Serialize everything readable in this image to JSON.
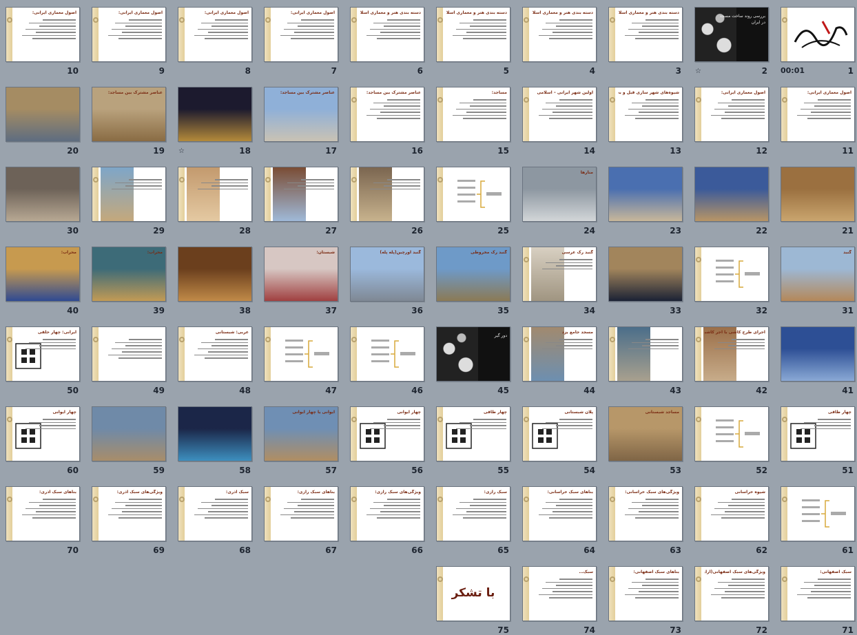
{
  "slides": [
    {
      "n": "1",
      "title": "",
      "kind": "calligraphy",
      "time": "00:01"
    },
    {
      "n": "2",
      "title": "بررسی روند ساخت مسجد در ایران",
      "kind": "dark",
      "star": "☆"
    },
    {
      "n": "3",
      "title": "دسته بندی هنر و معماری اسلامی",
      "kind": "text"
    },
    {
      "n": "4",
      "title": "دسته بندی هنر و معماری اسلامی",
      "kind": "text"
    },
    {
      "n": "5",
      "title": "دسته بندی هنر و معماری اسلامی",
      "kind": "text"
    },
    {
      "n": "6",
      "title": "دسته بندی هنر و معماری اسلامی",
      "kind": "text"
    },
    {
      "n": "7",
      "title": "اصول معماری ایرانی:",
      "kind": "text"
    },
    {
      "n": "8",
      "title": "اصول معماری ایرانی:",
      "kind": "text"
    },
    {
      "n": "9",
      "title": "اصول معماری ایرانی:",
      "kind": "text"
    },
    {
      "n": "10",
      "title": "اصول معماری ایرانی:",
      "kind": "text"
    },
    {
      "n": "11",
      "title": "اصول معماری ایرانی:",
      "kind": "text"
    },
    {
      "n": "12",
      "title": "اصول معماری ایرانی:",
      "kind": "text"
    },
    {
      "n": "13",
      "title": "شیوه‌های شهر سازی قبل و بعد اسلام:",
      "kind": "text"
    },
    {
      "n": "14",
      "title": "اولین شهر ایرانی – اسلامی",
      "kind": "text"
    },
    {
      "n": "15",
      "title": "مساجد:",
      "kind": "text"
    },
    {
      "n": "16",
      "title": "عناصر مشترک بین مساجد:",
      "kind": "text"
    },
    {
      "n": "17",
      "title": "عناصر مشترک بین مساجد:",
      "kind": "photo",
      "c1": "#8fb0d8",
      "c2": "#c9c2b4"
    },
    {
      "n": "18",
      "title": "",
      "kind": "photo",
      "c1": "#1c1a2e",
      "c2": "#b48a3a",
      "star": "☆"
    },
    {
      "n": "19",
      "title": "عناصر مشترک بین مساجد:",
      "kind": "photo",
      "c1": "#b9a27d",
      "c2": "#8a6c44"
    },
    {
      "n": "20",
      "title": "",
      "kind": "photo",
      "c1": "#a58c63",
      "c2": "#5e6d80"
    },
    {
      "n": "21",
      "title": "",
      "kind": "photo",
      "c1": "#9b7040",
      "c2": "#c9a56e"
    },
    {
      "n": "22",
      "title": "",
      "kind": "photo",
      "c1": "#3b5a9a",
      "c2": "#b89566"
    },
    {
      "n": "23",
      "title": "",
      "kind": "photo",
      "c1": "#4a6fb0",
      "c2": "#c8b79a"
    },
    {
      "n": "24",
      "title": "منارها",
      "kind": "photo",
      "c1": "#8d97a1",
      "c2": "#d2d6d8"
    },
    {
      "n": "25",
      "title": "",
      "kind": "diagram"
    },
    {
      "n": "26",
      "title": "",
      "kind": "halfphoto",
      "c1": "#7b6650",
      "c2": "#c7b28d"
    },
    {
      "n": "27",
      "title": "",
      "kind": "halfphoto",
      "c1": "#7a4c34",
      "c2": "#9fb9d8"
    },
    {
      "n": "28",
      "title": "",
      "kind": "halfphoto",
      "c1": "#c39a6e",
      "c2": "#e4c9a2"
    },
    {
      "n": "29",
      "title": "",
      "kind": "halfphoto",
      "c1": "#7ea6c8",
      "c2": "#c4a87c"
    },
    {
      "n": "30",
      "title": "",
      "kind": "photo",
      "c1": "#6d6258",
      "c2": "#b7a893"
    },
    {
      "n": "31",
      "title": "گنبد",
      "kind": "photo",
      "c1": "#9db8d4",
      "c2": "#b4885a"
    },
    {
      "n": "32",
      "title": "",
      "kind": "diagram"
    },
    {
      "n": "33",
      "title": "",
      "kind": "photo",
      "c1": "#a2855c",
      "c2": "#1b2235"
    },
    {
      "n": "34",
      "title": "گنبد رک عرسی",
      "kind": "halfphoto",
      "c1": "#d8d0c2",
      "c2": "#a09581"
    },
    {
      "n": "35",
      "title": "گنبد رک مخروطی",
      "kind": "photo",
      "c1": "#6e9ac8",
      "c2": "#8b7a55"
    },
    {
      "n": "36",
      "title": "گنبد اورچین(پله پله)",
      "kind": "photo",
      "c1": "#9bb9dc",
      "c2": "#7f8894"
    },
    {
      "n": "37",
      "title": "شبستان:",
      "kind": "photo",
      "c1": "#d7c7c3",
      "c2": "#a04040"
    },
    {
      "n": "38",
      "title": "",
      "kind": "photo",
      "c1": "#6b3f1d",
      "c2": "#c08a48"
    },
    {
      "n": "39",
      "title": "محراب:",
      "kind": "photo",
      "c1": "#3d6b78",
      "c2": "#c29a55"
    },
    {
      "n": "40",
      "title": "محراب:",
      "kind": "photo",
      "c1": "#c79a4f",
      "c2": "#2f4a92"
    },
    {
      "n": "41",
      "title": "",
      "kind": "photo",
      "c1": "#2d4f95",
      "c2": "#8aa9d5"
    },
    {
      "n": "42",
      "title": "اجرای طرح کاشی با آجر کاشی",
      "kind": "halfphoto",
      "c1": "#9b6f49",
      "c2": "#c7ac8a"
    },
    {
      "n": "43",
      "title": "",
      "kind": "halfphoto",
      "c1": "#4b6e8a",
      "c2": "#a8a08e"
    },
    {
      "n": "44",
      "title": "مسجد جامع یزد",
      "kind": "halfphoto",
      "c1": "#a18a6f",
      "c2": "#6d8fb0"
    },
    {
      "n": "45",
      "title": "دور گیر",
      "kind": "dark"
    },
    {
      "n": "46",
      "title": "",
      "kind": "diagram"
    },
    {
      "n": "47",
      "title": "",
      "kind": "diagram"
    },
    {
      "n": "48",
      "title": "عربی: شبستانی",
      "kind": "text"
    },
    {
      "n": "49",
      "title": "",
      "kind": "text"
    },
    {
      "n": "50",
      "title": "ایرانی: چهار حلقی",
      "kind": "plan"
    },
    {
      "n": "51",
      "title": "چهار طاقی",
      "kind": "plan"
    },
    {
      "n": "52",
      "title": "",
      "kind": "diagram"
    },
    {
      "n": "53",
      "title": "مساجد شبستانی",
      "kind": "photo",
      "c1": "#b79769",
      "c2": "#7f6546"
    },
    {
      "n": "54",
      "title": "پلان شبستانی",
      "kind": "plan"
    },
    {
      "n": "55",
      "title": "چهار طاقی",
      "kind": "plan"
    },
    {
      "n": "56",
      "title": "چهار ایوانی",
      "kind": "plan"
    },
    {
      "n": "57",
      "title": "ایوانی یا چهار ایوانی",
      "kind": "photo",
      "c1": "#6f8fb4",
      "c2": "#b08e63"
    },
    {
      "n": "58",
      "title": "",
      "kind": "photo",
      "c1": "#1b2648",
      "c2": "#3d8fbf"
    },
    {
      "n": "59",
      "title": "",
      "kind": "photo",
      "c1": "#6f8aa8",
      "c2": "#a88d6a"
    },
    {
      "n": "60",
      "title": "چهار ایوانی",
      "kind": "plan"
    },
    {
      "n": "61",
      "title": "",
      "kind": "diagram"
    },
    {
      "n": "62",
      "title": "شیوه خراسانی",
      "kind": "text"
    },
    {
      "n": "63",
      "title": "ویژگی‌های سبک خراسانی:",
      "kind": "text"
    },
    {
      "n": "64",
      "title": "بناهای سبک خراسانی:",
      "kind": "text"
    },
    {
      "n": "65",
      "title": "سبک رازی:",
      "kind": "text"
    },
    {
      "n": "66",
      "title": "ویژگی‌های سبک رازی:",
      "kind": "text"
    },
    {
      "n": "67",
      "title": "بناهای سبک رازی:",
      "kind": "text"
    },
    {
      "n": "68",
      "title": "سبک آذری:",
      "kind": "text"
    },
    {
      "n": "69",
      "title": "ویژگی‌های سبک آذری:",
      "kind": "text"
    },
    {
      "n": "70",
      "title": "بناهای سبک آذری:",
      "kind": "text"
    },
    {
      "n": "71",
      "title": "سبک اصفهانی:",
      "kind": "text"
    },
    {
      "n": "72",
      "title": "ویژگی‌های سبک اصفهانی(آرایش،تزئینات سبک معماری ایرانی):",
      "kind": "text"
    },
    {
      "n": "73",
      "title": "بناهای سبک اصفهانی:",
      "kind": "text"
    },
    {
      "n": "74",
      "title": "سبک…",
      "kind": "text"
    },
    {
      "n": "75",
      "title": "با تشکر",
      "kind": "thanks"
    }
  ]
}
